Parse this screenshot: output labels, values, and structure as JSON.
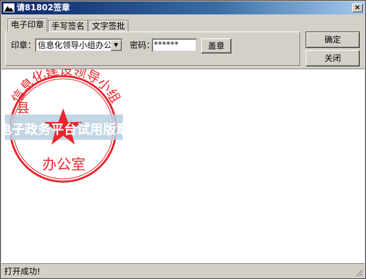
{
  "window": {
    "title": "请81802签章",
    "close_label": "×"
  },
  "tabs": [
    {
      "label": "电子印章",
      "active": true
    },
    {
      "label": "手写签名",
      "active": false
    },
    {
      "label": "文字签批",
      "active": false
    }
  ],
  "seal_form": {
    "seal_label": "印章：",
    "seal_selected": "信息化领导小组办公室",
    "password_label": "密码：",
    "password_value": "******",
    "stamp_button": "盖章"
  },
  "actions": {
    "confirm": "确定",
    "close": "关闭"
  },
  "stamp": {
    "color": "#e8262c",
    "top_text": "信息化建设领导小组",
    "prefix_text": "县",
    "bottom_text": "办公室",
    "watermark_text": "电子政务平台试用版章"
  },
  "status": {
    "message": "打开成功!"
  },
  "icons": {
    "app": "mountain-icon",
    "dropdown": "chevron-down-icon",
    "grip": "resize-grip-icon"
  }
}
